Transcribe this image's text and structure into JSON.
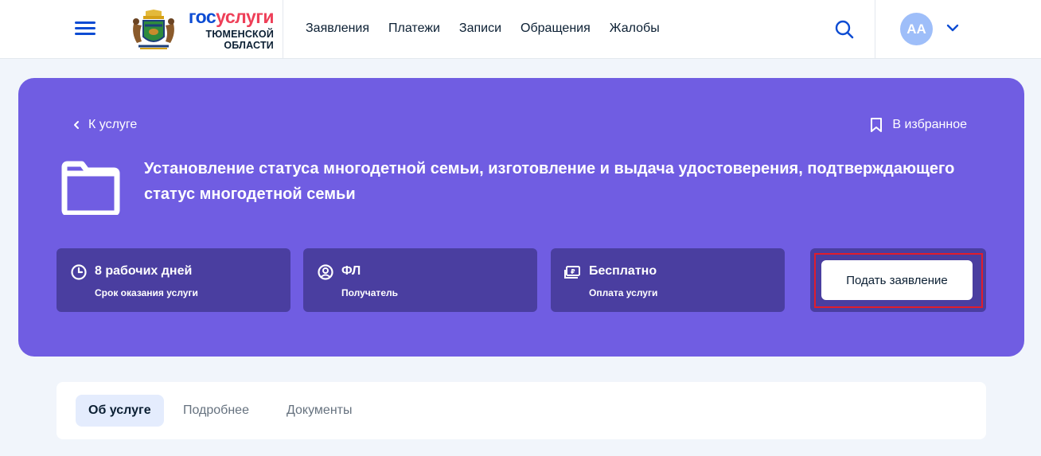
{
  "header": {
    "brand_gos": "гос",
    "brand_uslugi": "услуги",
    "brand_region_line1": "ТЮМЕНСКОЙ",
    "brand_region_line2": "ОБЛАСТИ",
    "nav": [
      {
        "label": "Заявления"
      },
      {
        "label": "Платежи"
      },
      {
        "label": "Записи"
      },
      {
        "label": "Обращения"
      },
      {
        "label": "Жалобы"
      }
    ],
    "avatar_initials": "АА",
    "icons": {
      "menu": "hamburger-icon",
      "search": "search-icon",
      "dropdown": "chevron-down-icon",
      "emblem": "coat-of-arms-logo"
    }
  },
  "banner": {
    "back_label": "К услуге",
    "favorite_label": "В избранное",
    "title": "Установление статуса многодетной семьи, изготовление и выдача удостоверения, подтверждающего статус многодетной семьи",
    "cards": [
      {
        "value": "8 рабочих дней",
        "label": "Срок оказания услуги",
        "icon": "clock-icon"
      },
      {
        "value": "ФЛ",
        "label": "Получатель",
        "icon": "user-circle-icon"
      },
      {
        "value": "Бесплатно",
        "label": "Оплата услуги",
        "icon": "payment-icon"
      }
    ],
    "submit_label": "Подать заявление",
    "colors": {
      "banner_bg": "#705de2",
      "card_bg": "#4a3ea0",
      "highlight": "#e11d2c"
    }
  },
  "tabs": [
    {
      "label": "Об услуге",
      "active": true
    },
    {
      "label": "Подробнее",
      "active": false
    },
    {
      "label": "Документы",
      "active": false
    }
  ]
}
